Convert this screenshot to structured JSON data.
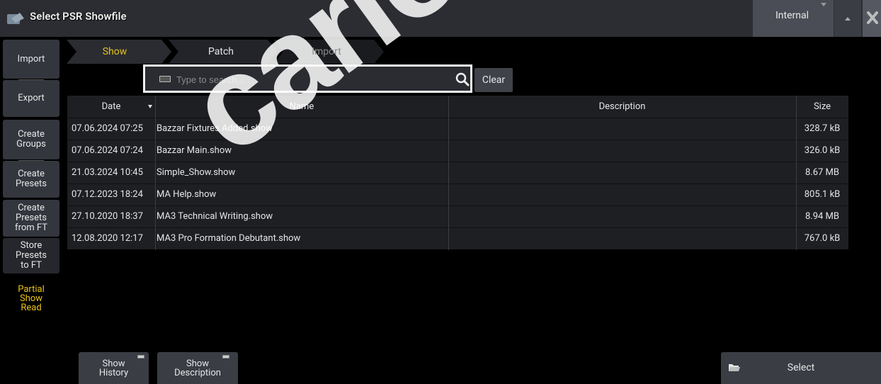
{
  "window": {
    "title": "Select PSR Showfile",
    "drive": "Internal",
    "icons": {
      "app": "psr-app-icon",
      "eject": "eject-icon",
      "close": "close-icon"
    }
  },
  "sidebar": {
    "import": "Import",
    "export": "Export",
    "create_groups": "Create Groups",
    "create_presets": "Create Presets",
    "create_presets_from_ft": "Create Presets from FT",
    "store_presets_to_ft": "Store Presets to FT",
    "partial_show_read": "Partial Show Read"
  },
  "tabs": [
    {
      "label": "Show",
      "state": "active"
    },
    {
      "label": "Patch",
      "state": "normal"
    },
    {
      "label": "Import",
      "state": "disabled"
    }
  ],
  "search": {
    "placeholder": "Type to search...",
    "value": "",
    "clear_label": "Clear"
  },
  "table": {
    "columns": [
      "Date",
      "Name",
      "Description",
      "Size"
    ],
    "sorted_column": "Date",
    "rows": [
      {
        "date": "07.06.2024 07:25",
        "name": "Bazzar Fixtures Added.show",
        "description": "",
        "size": "328.7 kB"
      },
      {
        "date": "07.06.2024 07:24",
        "name": "Bazzar Main.show",
        "description": "",
        "size": "326.0 kB"
      },
      {
        "date": "21.03.2024 10:45",
        "name": "Simple_Show.show",
        "description": "",
        "size": "8.67 MB"
      },
      {
        "date": "07.12.2023 18:24",
        "name": "MA Help.show",
        "description": "",
        "size": "805.1 kB"
      },
      {
        "date": "27.10.2020 18:37",
        "name": "MA3 Technical Writing.show",
        "description": "",
        "size": "8.94 MB"
      },
      {
        "date": "12.08.2020 12:17",
        "name": "MA3 Pro Formation Debutant.show",
        "description": "",
        "size": "767.0 kB"
      }
    ]
  },
  "bottom": {
    "show_history": "Show History",
    "show_description": "Show Description",
    "select": "Select"
  },
  "watermark": "carlosmendoza",
  "colors": {
    "active_tab": "#e8c21a",
    "partial_show_read": "#e8c21a"
  }
}
